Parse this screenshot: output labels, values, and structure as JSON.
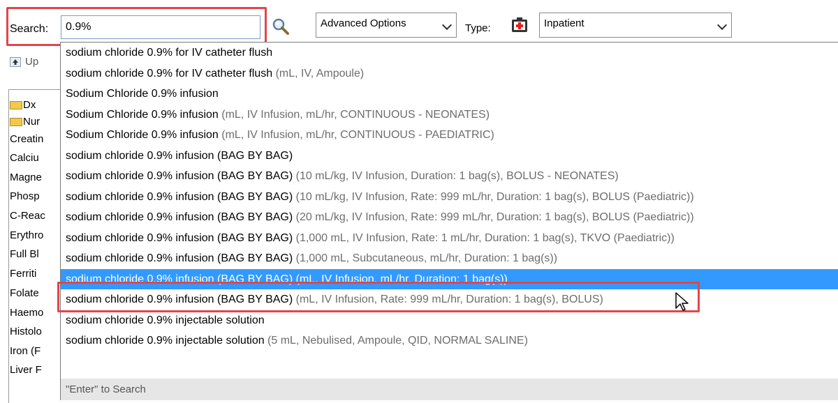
{
  "toolbar": {
    "search_label": "Search:",
    "search_value": "0.9%",
    "advanced_options": "Advanced Options",
    "type_label": "Type:",
    "type_value": "Inpatient"
  },
  "panel": {
    "up_label": "Up",
    "rows": [
      "Dx",
      "Nur",
      "Creatin",
      "Calciu",
      "Magne",
      "Phosp",
      "C-Reac",
      "Erythro",
      "Full Bl",
      "Ferriti",
      "Folate",
      "Haemo",
      "Histolo",
      "Iron (F",
      "Liver F"
    ]
  },
  "dropdown": {
    "items": [
      {
        "name": "sodium chloride 0.9% for IV catheter flush",
        "detail": ""
      },
      {
        "name": "sodium chloride 0.9% for IV catheter flush",
        "detail": " (mL, IV, Ampoule)"
      },
      {
        "name": "Sodium Chloride 0.9% infusion",
        "detail": ""
      },
      {
        "name": "Sodium Chloride 0.9% infusion",
        "detail": " (mL, IV Infusion, mL/hr, CONTINUOUS - NEONATES)"
      },
      {
        "name": "Sodium Chloride 0.9% infusion",
        "detail": " (mL, IV Infusion, mL/hr, CONTINUOUS - PAEDIATRIC)"
      },
      {
        "name": "sodium chloride 0.9% infusion (BAG BY BAG)",
        "detail": ""
      },
      {
        "name": "sodium chloride 0.9% infusion (BAG BY BAG)",
        "detail": " (10 mL/kg, IV Infusion, Duration: 1 bag(s), BOLUS - NEONATES)"
      },
      {
        "name": "sodium chloride 0.9% infusion (BAG BY BAG)",
        "detail": " (10 mL/kg, IV Infusion, Rate: 999 mL/hr, Duration: 1 bag(s), BOLUS (Paediatric))"
      },
      {
        "name": "sodium chloride 0.9% infusion (BAG BY BAG)",
        "detail": " (20 mL/kg, IV Infusion, Rate: 999 mL/hr, Duration: 1 bag(s), BOLUS (Paediatric))"
      },
      {
        "name": "sodium chloride 0.9% infusion (BAG BY BAG)",
        "detail": " (1,000 mL, IV Infusion, Rate: 1 mL/hr, Duration: 1 bag(s), TKVO (Paediatric))"
      },
      {
        "name": "sodium chloride 0.9% infusion (BAG BY BAG)",
        "detail": " (1,000 mL, Subcutaneous, mL/hr, Duration: 1 bag(s))"
      },
      {
        "name": "sodium chloride 0.9% infusion (BAG BY BAG) (mL, IV Infusion, mL/hr, Duration: 1 bag(s))",
        "detail": ""
      },
      {
        "name": "sodium chloride 0.9% infusion (BAG BY BAG)",
        "detail": " (mL, IV Infusion, Rate: 999 mL/hr, Duration: 1 bag(s), BOLUS)"
      },
      {
        "name": "sodium chloride 0.9% injectable solution",
        "detail": ""
      },
      {
        "name": "sodium chloride 0.9% injectable solution",
        "detail": " (5 mL, Nebulised, Ampoule, QID, NORMAL SALINE)"
      }
    ],
    "selected_index": 11,
    "footer": "\"Enter\" to Search"
  },
  "colors": {
    "accent_red": "#e4444b",
    "selection_blue": "#3399ff"
  },
  "icons": [
    "magnifier-icon",
    "chevron-down-icon",
    "patient-type-icon",
    "up-arrow-icon",
    "folder-icon",
    "mouse-cursor-icon"
  ]
}
